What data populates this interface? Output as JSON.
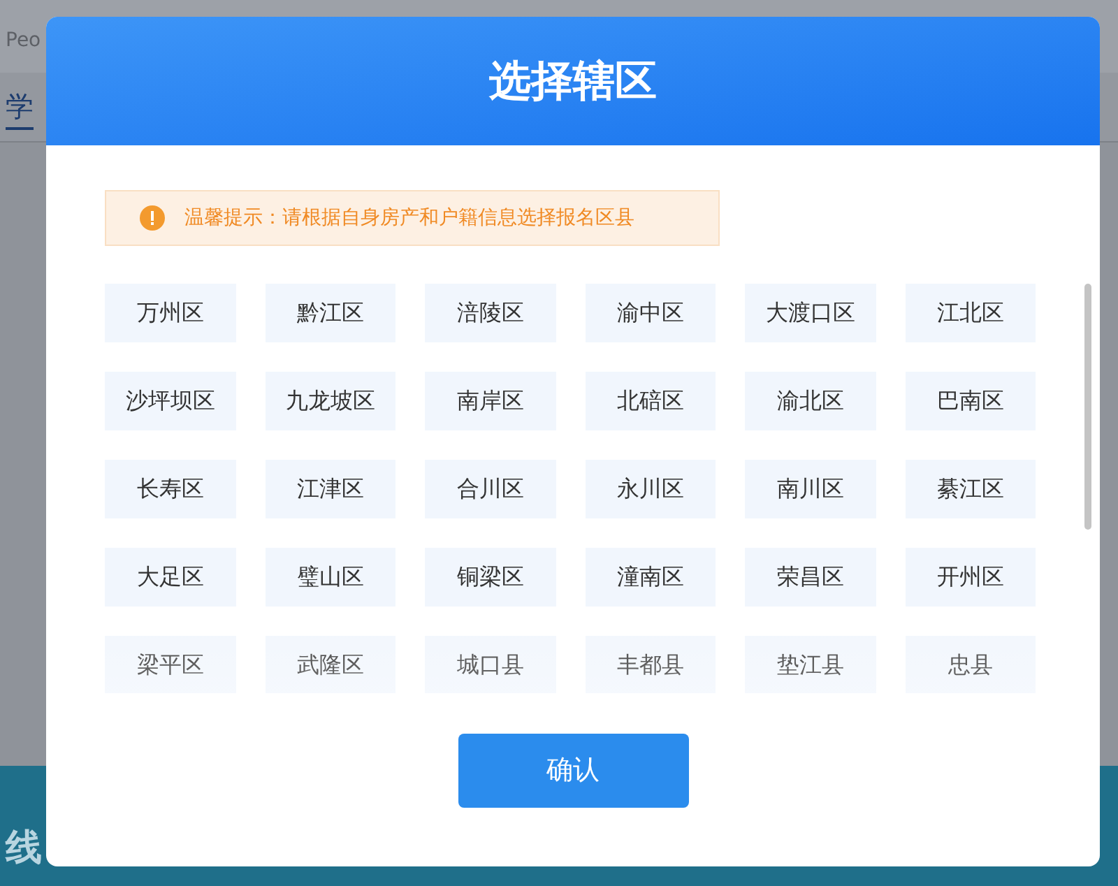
{
  "background": {
    "logo_subtitle": "Peo",
    "tab": "学",
    "banner_text": "线"
  },
  "dialog": {
    "title": "选择辖区",
    "tip": "温馨提示：请根据自身房产和户籍信息选择报名区县",
    "districts": [
      {
        "label": "万州区",
        "selected": false
      },
      {
        "label": "黔江区",
        "selected": false
      },
      {
        "label": "涪陵区",
        "selected": false
      },
      {
        "label": "渝中区",
        "selected": false
      },
      {
        "label": "大渡口区",
        "selected": false
      },
      {
        "label": "江北区",
        "selected": false
      },
      {
        "label": "沙坪坝区",
        "selected": false
      },
      {
        "label": "九龙坡区",
        "selected": false
      },
      {
        "label": "南岸区",
        "selected": false
      },
      {
        "label": "北碚区",
        "selected": false
      },
      {
        "label": "渝北区",
        "selected": false
      },
      {
        "label": "巴南区",
        "selected": false
      },
      {
        "label": "长寿区",
        "selected": false
      },
      {
        "label": "江津区",
        "selected": false
      },
      {
        "label": "合川区",
        "selected": false
      },
      {
        "label": "永川区",
        "selected": false
      },
      {
        "label": "南川区",
        "selected": false
      },
      {
        "label": "綦江区",
        "selected": false
      },
      {
        "label": "大足区",
        "selected": false
      },
      {
        "label": "璧山区",
        "selected": false
      },
      {
        "label": "铜梁区",
        "selected": false
      },
      {
        "label": "潼南区",
        "selected": false
      },
      {
        "label": "荣昌区",
        "selected": false
      },
      {
        "label": "开州区",
        "selected": false
      },
      {
        "label": "梁平区",
        "selected": false
      },
      {
        "label": "武隆区",
        "selected": false
      },
      {
        "label": "城口县",
        "selected": false
      },
      {
        "label": "丰都县",
        "selected": false
      },
      {
        "label": "垫江县",
        "selected": false
      },
      {
        "label": "忠县",
        "selected": false
      }
    ],
    "confirm": "确认"
  }
}
